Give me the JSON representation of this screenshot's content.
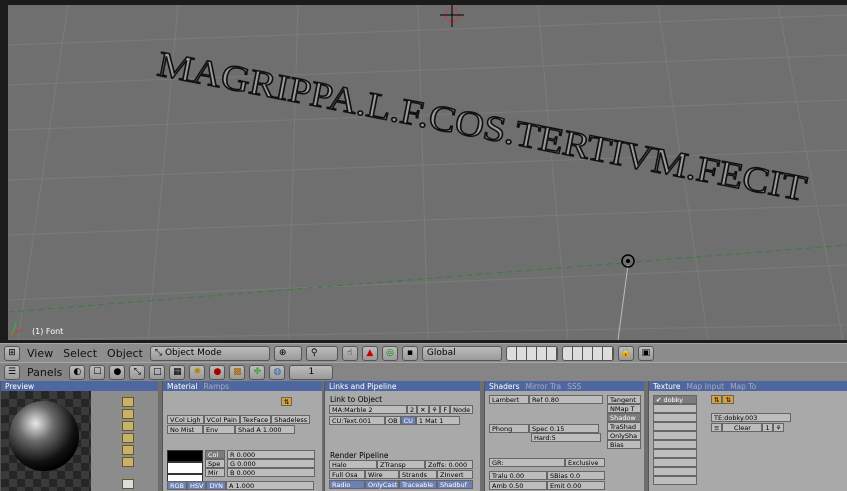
{
  "viewport": {
    "text3d": "MAGRIPPA.L.F.COS.TERTIVM.FECIT",
    "object_label": "(1) Font"
  },
  "header1": {
    "menus": [
      "View",
      "Select",
      "Object"
    ],
    "mode": "Object Mode",
    "orientation": "Global",
    "layer_num": ""
  },
  "header2": {
    "panels_label": "Panels",
    "frame": "1"
  },
  "preview": {
    "tab": "Preview"
  },
  "material": {
    "tab_active": "Material",
    "tab_inactive": "Ramps",
    "vcol_light": "VCol Ligh",
    "vcol_paint": "VCol Pain",
    "texface": "TexFace",
    "shadeless": "Shadeless",
    "no_mist": "No Mist",
    "env": "Env",
    "shad_a": "Shad A 1.000",
    "col": "Col",
    "spe": "Spe",
    "mir": "Mir",
    "r": "R 0.000",
    "g": "G 0.000",
    "bval": "B 0.000",
    "a": "A 1.000",
    "rgb": "RGB",
    "hsv": "HSV",
    "dyn": "DYN"
  },
  "links": {
    "tab": "Links and Pipeline",
    "link_to_object": "Link to Object",
    "ma_name": "MA:Marble 2",
    "users": "2",
    "f": "F",
    "node": "Node",
    "cu_name": "CU:Text.001",
    "ob": "OB",
    "cu": "CU",
    "mat": "1 Mat 1",
    "render_pipeline": "Render Pipeline",
    "halo": "Halo",
    "ztransp": "ZTransp",
    "zoffs": "Zoffs: 0.000",
    "full_osa": "Full Osa",
    "wire": "Wire",
    "strands": "Strands",
    "zinvert": "ZInvert",
    "radio": "Radio",
    "onlycast": "OnlyCast",
    "traceable": "Traceable",
    "shadbuf": "Shadbuf"
  },
  "shaders": {
    "tab_active": "Shaders",
    "tab_mirror": "Mirror Tra",
    "tab_sss": "SSS",
    "lambert": "Lambert",
    "ref": "Ref  0.80",
    "phong": "Phong",
    "spec": "Spec 0.15",
    "hard": "Hard:5",
    "tangent": "Tangent",
    "nmap": "NMap T",
    "shadow": "Shadow",
    "trashad": "TraShad",
    "onlysha": "OnlySha",
    "bias": "Bias",
    "gr": "GR:",
    "exclusive": "Exclusive",
    "tralu": "Tralu 0.00",
    "sbias": "SBias 0.0",
    "amb": "Amb 0.50",
    "emit": "Emit 0.00"
  },
  "texture": {
    "tab_active": "Texture",
    "tab_map_input": "Map Input",
    "tab_map_to": "Map To",
    "slot": "dobky",
    "te_name": "TE:dobky.003",
    "clear": "Clear",
    "users": "1"
  }
}
